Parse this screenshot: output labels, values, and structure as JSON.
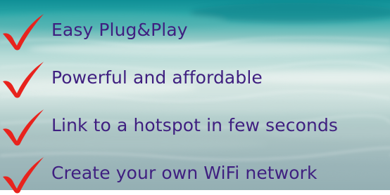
{
  "background": {
    "image": "tropical-beach-water",
    "colors": {
      "water_top": "#0f8f96",
      "water_mid": "#d7e7e3",
      "water_bottom": "#94afb3"
    }
  },
  "features": {
    "icon": "red-checkmark-icon",
    "icon_color": "#e8231d",
    "text_color": "#3f1f80",
    "items": [
      {
        "label": "Easy Plug&Play"
      },
      {
        "label": "Powerful and affordable"
      },
      {
        "label": "Link to a hotspot in few seconds"
      },
      {
        "label": "Create your own WiFi network"
      }
    ]
  }
}
